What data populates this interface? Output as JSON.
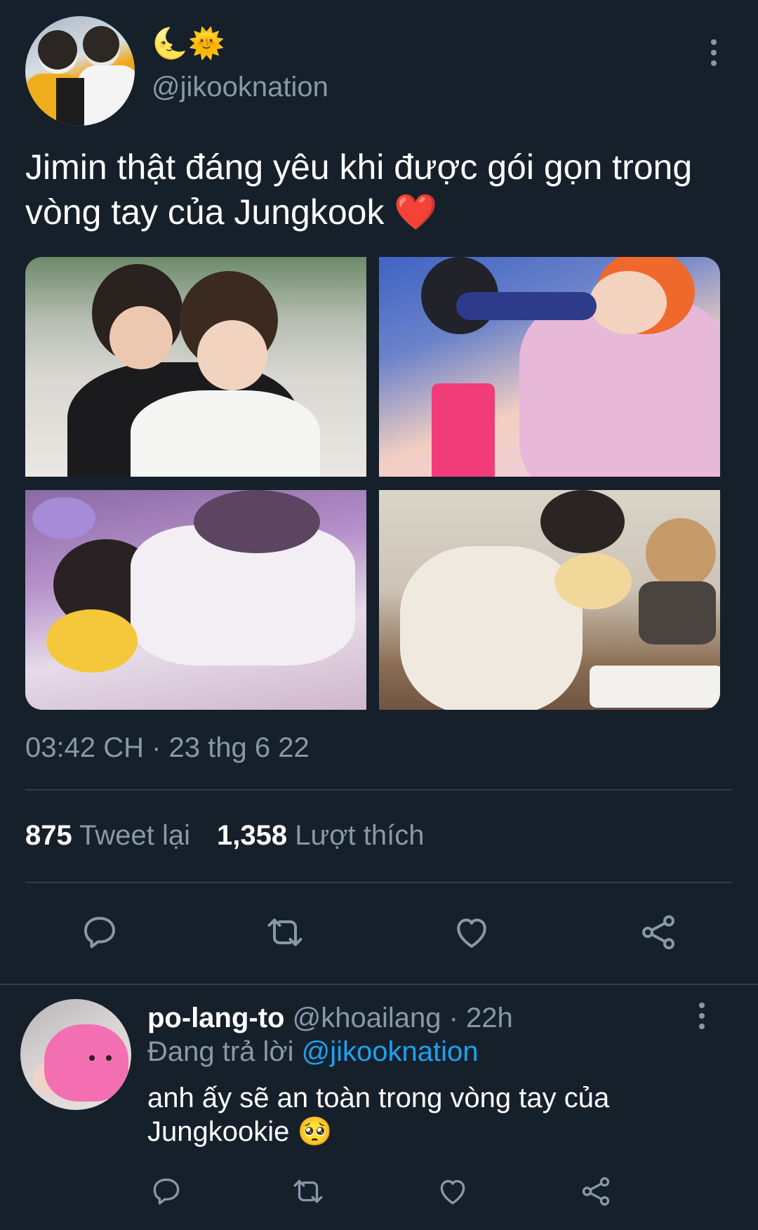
{
  "tweet": {
    "display_name": "🌜🌞",
    "handle": "@jikooknation",
    "text": "Jimin thật đáng yêu khi được gói gọn trong vòng tay của Jungkook ❤️",
    "timestamp": "03:42 CH · 23 thg 6 22",
    "retweets_count": "875",
    "retweets_label": "Tweet lại",
    "likes_count": "1,358",
    "likes_label": "Lượt thích"
  },
  "reply": {
    "display_name": "po-lang-to",
    "handle_time": "@khoailang · 22h",
    "replying_prefix": "Đang trả lời",
    "replying_to": "@jikooknation",
    "text": "anh ấy sẽ an toàn trong vòng tay của Jungkookie 🥺"
  },
  "icons": {
    "reply": "reply-icon",
    "retweet": "retweet-icon",
    "like": "heart-icon",
    "share": "share-icon",
    "more": "more-vertical-icon"
  },
  "colors": {
    "background": "#15202b",
    "muted": "#8899a6",
    "link": "#1da1f2",
    "divider": "#2f3b47"
  }
}
